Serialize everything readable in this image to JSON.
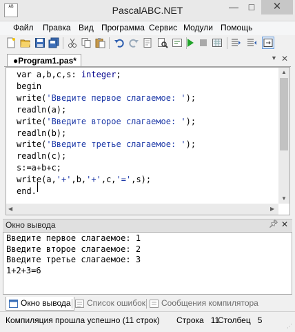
{
  "window": {
    "title": "PascalABC.NET",
    "icon_text": "AB"
  },
  "menu": [
    "Файл",
    "Правка",
    "Вид",
    "Программа",
    "Сервис",
    "Модули",
    "Помощь"
  ],
  "editor": {
    "tab_label": "●Program1.pas*",
    "lines": [
      {
        "parts": [
          {
            "t": "var a,b,c,s: ",
            "c": "plain"
          },
          {
            "t": "integer",
            "c": "kw"
          },
          {
            "t": ";",
            "c": "plain"
          }
        ]
      },
      {
        "parts": [
          {
            "t": "begin",
            "c": "plain"
          }
        ]
      },
      {
        "parts": [
          {
            "t": "write(",
            "c": "plain"
          },
          {
            "t": "'Введите первое слагаемое: '",
            "c": "str"
          },
          {
            "t": ");",
            "c": "plain"
          }
        ]
      },
      {
        "parts": [
          {
            "t": "readln(a);",
            "c": "plain"
          }
        ]
      },
      {
        "parts": [
          {
            "t": "write(",
            "c": "plain"
          },
          {
            "t": "'Введите второе слагаемое: '",
            "c": "str"
          },
          {
            "t": ");",
            "c": "plain"
          }
        ]
      },
      {
        "parts": [
          {
            "t": "readln(b);",
            "c": "plain"
          }
        ]
      },
      {
        "parts": [
          {
            "t": "write(",
            "c": "plain"
          },
          {
            "t": "'Введите третье слагаемое: '",
            "c": "str"
          },
          {
            "t": ");",
            "c": "plain"
          }
        ]
      },
      {
        "parts": [
          {
            "t": "readln(c);",
            "c": "plain"
          }
        ]
      },
      {
        "parts": [
          {
            "t": "s:=a+b+c;",
            "c": "plain"
          }
        ]
      },
      {
        "parts": [
          {
            "t": "write(a,",
            "c": "plain"
          },
          {
            "t": "'+'",
            "c": "str"
          },
          {
            "t": ",b,",
            "c": "plain"
          },
          {
            "t": "'+'",
            "c": "str"
          },
          {
            "t": ",c,",
            "c": "plain"
          },
          {
            "t": "'='",
            "c": "str"
          },
          {
            "t": ",s);",
            "c": "plain"
          }
        ]
      },
      {
        "parts": [
          {
            "t": "end.",
            "c": "plain"
          }
        ]
      }
    ]
  },
  "output": {
    "title": "Окно вывода",
    "lines": [
      "Введите первое слагаемое: 1",
      "Введите второе слагаемое: 2",
      "Введите третье слагаемое: 3",
      "1+2+3=6"
    ]
  },
  "bottom_tabs": {
    "output": "Окно вывода",
    "errors": "Список ошибок",
    "compiler": "Сообщения компилятора"
  },
  "status": {
    "message": "Компиляция прошла успешно (11 строк)",
    "row_label": "Строка",
    "row_value": "11",
    "col_label": "Столбец",
    "col_value": "5"
  },
  "colors": {
    "string": "#1e3aa8",
    "keyword": "#00008b",
    "run_green": "#21a32a",
    "stop_red": "#d33b2f"
  }
}
